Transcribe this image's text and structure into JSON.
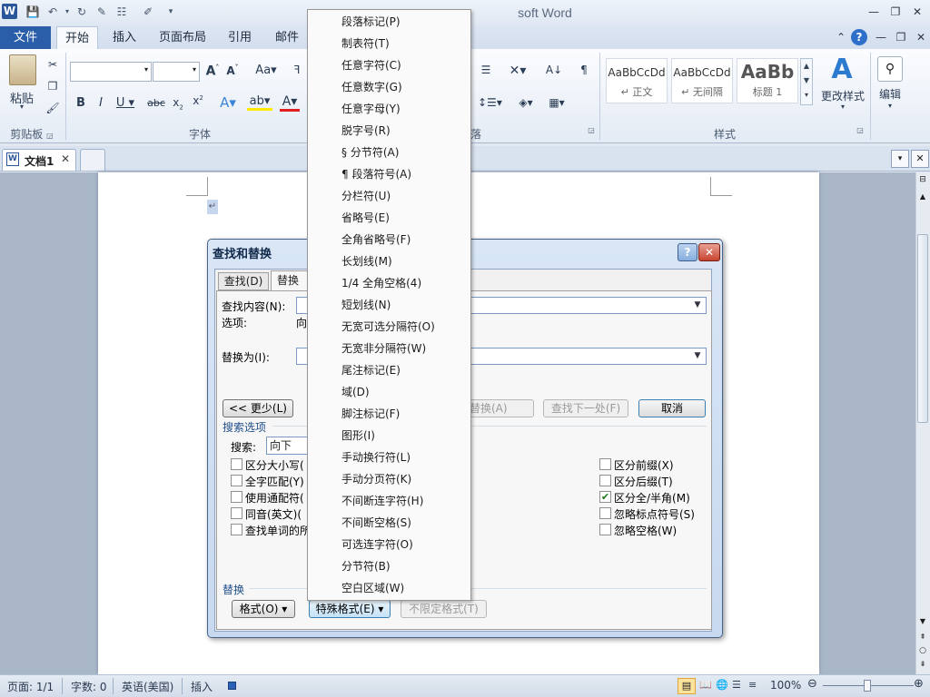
{
  "app": {
    "window_title": "文档1 - Microsoft Word",
    "window_title_visible": "soft Word",
    "logo_letter": "W"
  },
  "ribbon": {
    "tabs": [
      "文件",
      "开始",
      "插入",
      "页面布局",
      "引用",
      "邮件"
    ],
    "active_tab": "开始",
    "groups": {
      "clipboard": "剪贴板",
      "font": "字体",
      "paragraph": "落",
      "styles": "样式"
    },
    "paste_label": "粘贴",
    "styles": [
      {
        "preview": "AaBbCcDd",
        "name": "↵ 正文"
      },
      {
        "preview": "AaBbCcDd",
        "name": "↵ 无间隔"
      },
      {
        "preview": "AaBb",
        "name": "标题 1"
      }
    ],
    "change_styles_label": "更改样式",
    "edit_label": "编辑"
  },
  "document": {
    "tab_name": "文档1",
    "para_mark": "↵"
  },
  "dialog": {
    "title": "查找和替换",
    "tabs": [
      "查找(D)",
      "替换(P)"
    ],
    "find_label": "查找内容(N):",
    "options_label": "选项:",
    "options_value": "向",
    "replace_label": "替换为(I):",
    "less_button": "<< 更少(L)",
    "replace_button": "替换(A)",
    "find_next_button": "查找下一处(F)",
    "cancel_button": "取消",
    "search_options_title": "搜索选项",
    "search_label": "搜索:",
    "search_value": "向下",
    "checkboxes_left": [
      {
        "label": "区分大小写(",
        "checked": false
      },
      {
        "label": "全字匹配(Y)",
        "checked": false
      },
      {
        "label": "使用通配符(",
        "checked": false
      },
      {
        "label": "同音(英文)(",
        "checked": false
      },
      {
        "label": "查找单词的所",
        "checked": false
      }
    ],
    "checkboxes_right": [
      {
        "label": "区分前缀(X)",
        "checked": false
      },
      {
        "label": "区分后缀(T)",
        "checked": false
      },
      {
        "label": "区分全/半角(M)",
        "checked": true
      },
      {
        "label": "忽略标点符号(S)",
        "checked": false
      },
      {
        "label": "忽略空格(W)",
        "checked": false
      }
    ],
    "replace_section_title": "替换",
    "format_button": "格式(O) ▾",
    "special_button": "特殊格式(E) ▾",
    "no_format_button": "不限定格式(T)"
  },
  "special_menu": {
    "items": [
      "段落标记(P)",
      "制表符(T)",
      "任意字符(C)",
      "任意数字(G)",
      "任意字母(Y)",
      "脱字号(R)",
      "§ 分节符(A)",
      "¶ 段落符号(A)",
      "分栏符(U)",
      "省略号(E)",
      "全角省略号(F)",
      "长划线(M)",
      "1/4 全角空格(4)",
      "短划线(N)",
      "无宽可选分隔符(O)",
      "无宽非分隔符(W)",
      "尾注标记(E)",
      "域(D)",
      "脚注标记(F)",
      "图形(I)",
      "手动换行符(L)",
      "手动分页符(K)",
      "不间断连字符(H)",
      "不间断空格(S)",
      "可选连字符(O)",
      "分节符(B)",
      "空白区域(W)"
    ]
  },
  "status": {
    "page": "页面: 1/1",
    "words": "字数: 0",
    "language": "英语(美国)",
    "mode": "插入",
    "zoom": "100%"
  }
}
